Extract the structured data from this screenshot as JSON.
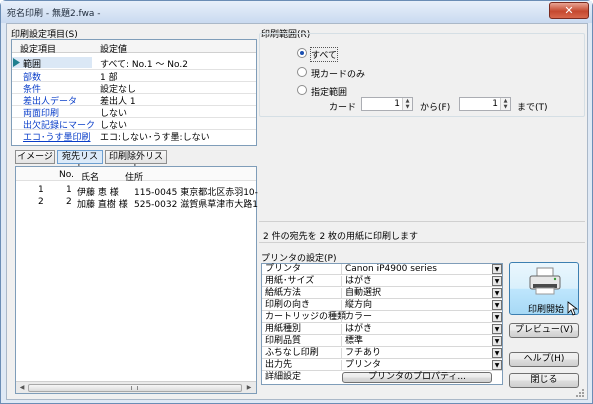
{
  "window": {
    "title": "宛名印刷 - 無題2.fwa -",
    "close_label": "✕"
  },
  "print_items": {
    "title": "印刷設定項目(S)",
    "col_item": "設定項目",
    "col_value": "設定値",
    "rows": [
      {
        "item": "範囲",
        "value": "すべて: No.1 〜 No.2"
      },
      {
        "item": "部数",
        "value": "1 部"
      },
      {
        "item": "条件",
        "value": "設定なし"
      },
      {
        "item": "差出人データ",
        "value": "差出人 1"
      },
      {
        "item": "両面印刷",
        "value": "しない"
      },
      {
        "item": "出欠記録にマーク",
        "value": "しない"
      },
      {
        "item": "エコ･うす墨印刷",
        "value": "エコ:しない･うす墨:しない"
      }
    ]
  },
  "tabs": [
    "イメージ",
    "宛先リスト",
    "印刷除外リスト"
  ],
  "address_list": {
    "columns": [
      "No.",
      "氏名",
      "住所"
    ],
    "rows": [
      {
        "idx": "1",
        "no": "1",
        "name": "伊藤 恵 様",
        "addr": "115-0045 東京都北区赤羽10-"
      },
      {
        "idx": "2",
        "no": "2",
        "name": "加藤 直樹 様",
        "addr": "525-0032 滋賀県草津市大路1"
      }
    ]
  },
  "print_range": {
    "title": "印刷範囲(R)",
    "options": [
      "すべて",
      "現カードのみ",
      "指定範囲"
    ],
    "selected": 0,
    "card_label": "カード",
    "from_value": "1",
    "from_label": "から(F)",
    "to_value": "1",
    "to_label": "まで(T)"
  },
  "status_text": "2 件の宛先を 2 枚の用紙に印刷します",
  "printer_settings": {
    "title": "プリンタの設定(P)",
    "rows": [
      {
        "key": "プリンタ",
        "value": "Canon iP4900 series"
      },
      {
        "key": "用紙･サイズ",
        "value": "はがき"
      },
      {
        "key": "給紙方法",
        "value": "自動選択"
      },
      {
        "key": "印刷の向き",
        "value": "縦方向"
      },
      {
        "key": "カートリッジの種類",
        "value": "カラー"
      },
      {
        "key": "用紙種別",
        "value": "はがき"
      },
      {
        "key": "印刷品質",
        "value": "標準"
      },
      {
        "key": "ふちなし印刷",
        "value": "フチあり"
      },
      {
        "key": "出力先",
        "value": "プリンタ"
      },
      {
        "key": "詳細設定",
        "value": "プリンタのプロパティ..."
      }
    ]
  },
  "buttons": {
    "print": "印刷開始",
    "preview": "プレビュー(V)",
    "help": "ヘルプ(H)",
    "close": "閉じる"
  },
  "icons": {
    "printer": "printer-icon",
    "pointer": "selected-row-arrow-icon",
    "cursor": "mouse-cursor-icon"
  }
}
